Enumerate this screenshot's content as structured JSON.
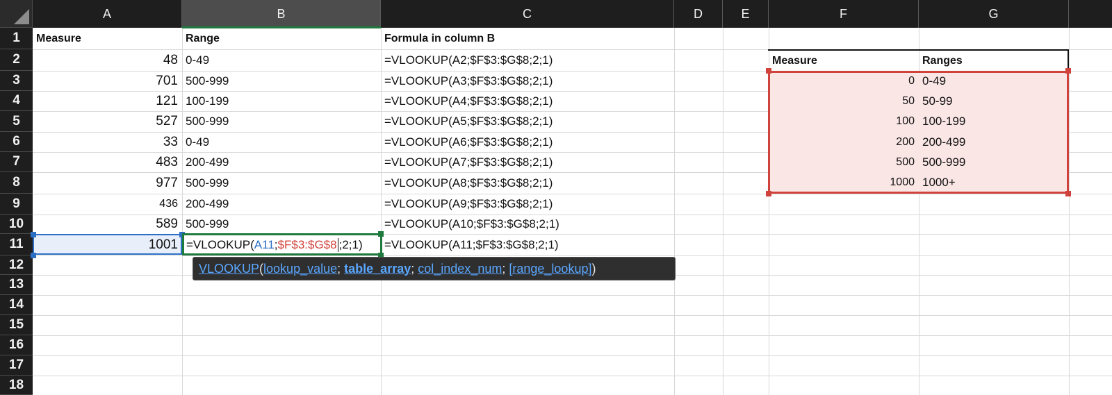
{
  "columns": [
    {
      "label": "A",
      "selected": false
    },
    {
      "label": "B",
      "selected": true
    },
    {
      "label": "C",
      "selected": false
    },
    {
      "label": "D",
      "selected": false
    },
    {
      "label": "E",
      "selected": false
    },
    {
      "label": "F",
      "selected": false
    },
    {
      "label": "G",
      "selected": false
    }
  ],
  "rows": [
    "1",
    "2",
    "3",
    "4",
    "5",
    "6",
    "7",
    "8",
    "9",
    "10",
    "11",
    "12",
    "13",
    "14",
    "15",
    "16",
    "17",
    "18"
  ],
  "headers": {
    "measure": "Measure",
    "range": "Range",
    "formula": "Formula in column B"
  },
  "data_rows": [
    {
      "measure": "48",
      "range": "0-49",
      "formula": "=VLOOKUP(A2;$F$3:$G$8;2;1)"
    },
    {
      "measure": "701",
      "range": "500-999",
      "formula": "=VLOOKUP(A3;$F$3:$G$8;2;1)"
    },
    {
      "measure": "121",
      "range": "100-199",
      "formula": "=VLOOKUP(A4;$F$3:$G$8;2;1)"
    },
    {
      "measure": "527",
      "range": "500-999",
      "formula": "=VLOOKUP(A5;$F$3:$G$8;2;1)"
    },
    {
      "measure": "33",
      "range": "0-49",
      "formula": "=VLOOKUP(A6;$F$3:$G$8;2;1)"
    },
    {
      "measure": "483",
      "range": "200-499",
      "formula": "=VLOOKUP(A7;$F$3:$G$8;2;1)"
    },
    {
      "measure": "977",
      "range": "500-999",
      "formula": "=VLOOKUP(A8;$F$3:$G$8;2;1)"
    },
    {
      "measure": "436",
      "range": "200-499",
      "formula": "=VLOOKUP(A9;$F$3:$G$8;2;1)"
    },
    {
      "measure": "589",
      "range": "500-999",
      "formula": "=VLOOKUP(A10;$F$3:$G$8;2;1)"
    },
    {
      "measure": "1001",
      "range": "",
      "formula": "=VLOOKUP(A11;$F$3:$G$8;2;1)"
    }
  ],
  "editing_cell": {
    "prefix": "=VLOOKUP(",
    "arg1": "A11",
    "sep1": ";",
    "arg2": "$F$3:$G$8",
    "rest": ";2;1)"
  },
  "tooltip": {
    "fn": "VLOOKUP",
    "open": "(",
    "p1": "lookup_value",
    "sep": ";",
    "p2": "table_array",
    "p3": "col_index_num",
    "p4": "[range_lookup]",
    "close": ")"
  },
  "lookup_table": {
    "header_measure": "Measure",
    "header_ranges": "Ranges",
    "rows": [
      {
        "measure": "0",
        "range": "0-49"
      },
      {
        "measure": "50",
        "range": "50-99"
      },
      {
        "measure": "100",
        "range": "100-199"
      },
      {
        "measure": "200",
        "range": "200-499"
      },
      {
        "measure": "500",
        "range": "500-999"
      },
      {
        "measure": "1000",
        "range": "1000+"
      }
    ]
  },
  "colors": {
    "reference_blue": "#2d6fc4",
    "reference_red": "#d0433d",
    "edit_border_green": "#1f7a3e",
    "header_dark": "#1e1e1e"
  }
}
